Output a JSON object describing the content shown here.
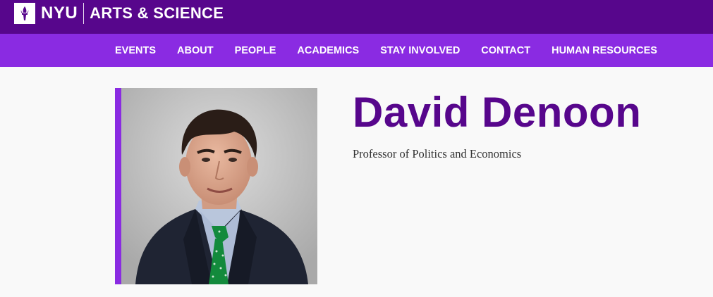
{
  "header": {
    "brand_short": "NYU",
    "brand_school": "ARTS & SCIENCE",
    "logo_icon": "torch-icon",
    "color": "#57068c"
  },
  "nav": {
    "color": "#8a2be2",
    "items": [
      {
        "label": "EVENTS"
      },
      {
        "label": "ABOUT"
      },
      {
        "label": "PEOPLE"
      },
      {
        "label": "ACADEMICS"
      },
      {
        "label": "STAY INVOLVED"
      },
      {
        "label": "CONTACT"
      },
      {
        "label": "HUMAN RESOURCES"
      }
    ]
  },
  "profile": {
    "name": "David Denoon",
    "title": "Professor of Politics and Economics",
    "accent_color": "#8a2be2",
    "name_color": "#57068c"
  }
}
